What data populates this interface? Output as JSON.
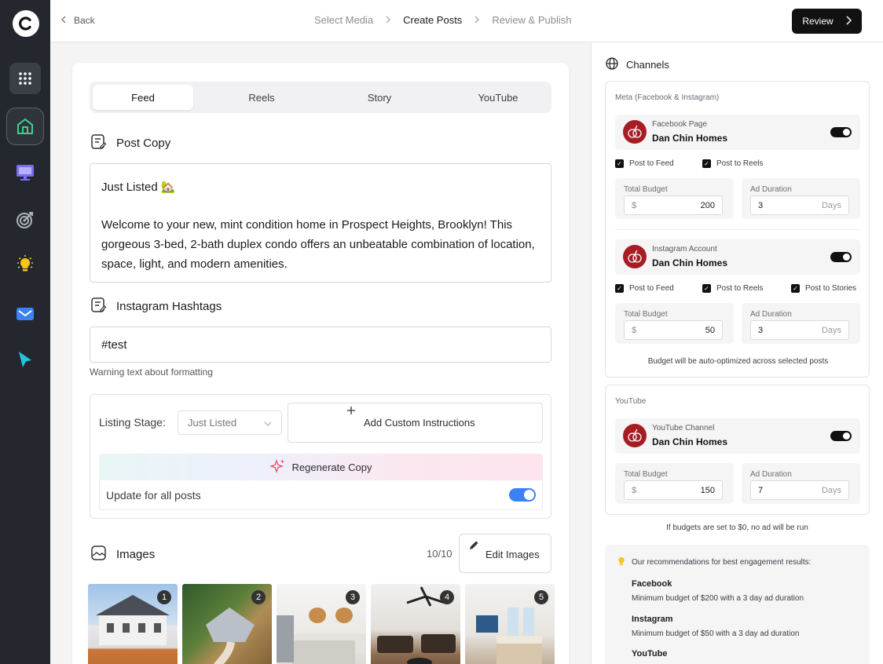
{
  "nav": {
    "back_label": "Back",
    "steps": [
      "Select Media",
      "Create Posts",
      "Review & Publish"
    ],
    "review_label": "Review"
  },
  "sidebar": {
    "icons": [
      "grid-icon",
      "home-icon",
      "monitor-icon",
      "target-icon",
      "lightbulb-icon",
      "mail-icon",
      "cursor-icon"
    ]
  },
  "tabs": [
    "Feed",
    "Reels",
    "Story",
    "YouTube"
  ],
  "post_copy": {
    "title": "Post Copy",
    "line1": "Just Listed 🏡",
    "body": "Welcome to your new, mint condition home in Prospect Heights, Brooklyn! This gorgeous 3-bed, 2-bath duplex condo offers an unbeatable combination of location, space, light, and modern amenities."
  },
  "hashtags": {
    "title": "Instagram Hashtags",
    "value": "#test",
    "warning": "Warning text about formatting"
  },
  "listing": {
    "label": "Listing Stage:",
    "value": "Just Listed",
    "custom_label": "Add Custom Instructions",
    "regen_label": "Regenerate Copy",
    "update_label": "Update for all posts"
  },
  "images": {
    "title": "Images",
    "count": "10/10",
    "edit_label": "Edit Images",
    "numbers": [
      "1",
      "2",
      "3",
      "4",
      "5"
    ]
  },
  "channels": {
    "title": "Channels",
    "meta_label": "Meta (Facebook & Instagram)",
    "facebook": {
      "type": "Facebook Page",
      "name": "Dan Chin Homes",
      "checks": [
        "Post to Feed",
        "Post to Reels"
      ],
      "budget_label": "Total Budget",
      "budget_prefix": "$",
      "budget": "200",
      "duration_label": "Ad Duration",
      "duration": "3",
      "duration_suffix": "Days"
    },
    "instagram": {
      "type": "Instagram Account",
      "name": "Dan Chin Homes",
      "checks": [
        "Post to Feed",
        "Post to Reels",
        "Post to Stories"
      ],
      "budget_label": "Total Budget",
      "budget_prefix": "$",
      "budget": "50",
      "duration_label": "Ad Duration",
      "duration": "3",
      "duration_suffix": "Days"
    },
    "meta_note": "Budget will be auto-optimized across selected posts",
    "youtube_label": "YouTube",
    "youtube": {
      "type": "YouTube Channel",
      "name": "Dan Chin Homes",
      "budget_label": "Total Budget",
      "budget_prefix": "$",
      "budget": "150",
      "duration_label": "Ad Duration",
      "duration": "7",
      "duration_suffix": "Days"
    },
    "zero_note": "If budgets are set to $0, no ad will be run"
  },
  "recommendations": {
    "head": "Our recommendations for best engagement results:",
    "items": [
      {
        "platform": "Facebook",
        "text": "Minimum budget of $200 with a 3 day ad duration"
      },
      {
        "platform": "Instagram",
        "text": "Minimum budget of $50 with a 3 day ad duration"
      },
      {
        "platform": "YouTube",
        "text": ""
      }
    ]
  },
  "colors": {
    "accent_blue": "#3b82f6",
    "sidebar_bg": "#24282e",
    "brand_red": "#a61d24"
  }
}
